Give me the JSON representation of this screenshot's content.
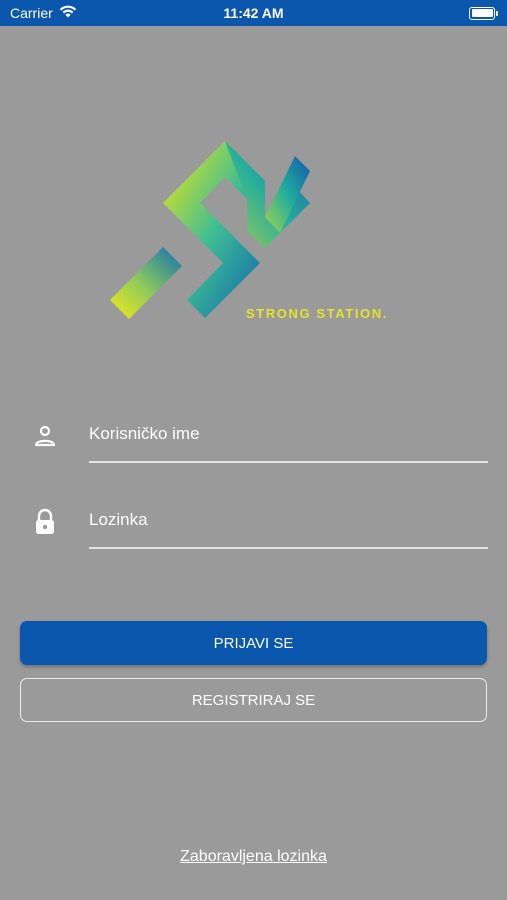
{
  "status_bar": {
    "carrier": "Carrier",
    "time": "11:42 AM"
  },
  "brand": {
    "name": "STRONG STATION.",
    "text_color": "#e6e32a"
  },
  "form": {
    "username_placeholder": "Korisničko ime",
    "password_placeholder": "Lozinka"
  },
  "buttons": {
    "login_label": "PRIJAVI SE",
    "register_label": "REGISTRIRAJ SE"
  },
  "links": {
    "forgot_password": "Zaboravljena lozinka"
  },
  "colors": {
    "primary": "#0a57ad",
    "background": "#9a9a9a"
  },
  "icons": {
    "username": "person-icon",
    "password": "lock-icon"
  }
}
